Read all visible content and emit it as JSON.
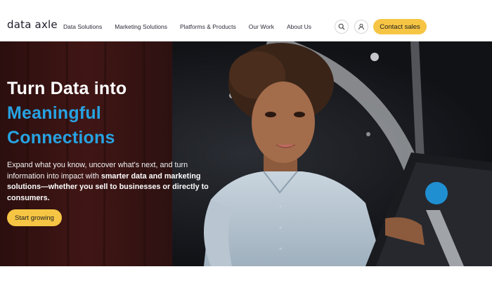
{
  "brand": {
    "logo_text": "data axle"
  },
  "nav": {
    "links": [
      "Data Solutions",
      "Marketing Solutions",
      "Platforms & Products",
      "Our Work",
      "About Us"
    ],
    "contact_label": "Contact sales"
  },
  "hero": {
    "headline": [
      "Turn Data into",
      "Meaningful",
      "Connections"
    ],
    "subtext_plain": "Expand what you know, uncover what's next, and turn information into impact with ",
    "subtext_bold": "smarter data and marketing solutions—whether you sell to businesses or directly to consumers.",
    "cta_label": "Start growing"
  },
  "colors": {
    "accent_yellow": "#f6c544",
    "accent_blue": "#27a3e2",
    "hero_dark": "#15161a"
  },
  "icons": [
    "search-icon",
    "user-icon"
  ]
}
